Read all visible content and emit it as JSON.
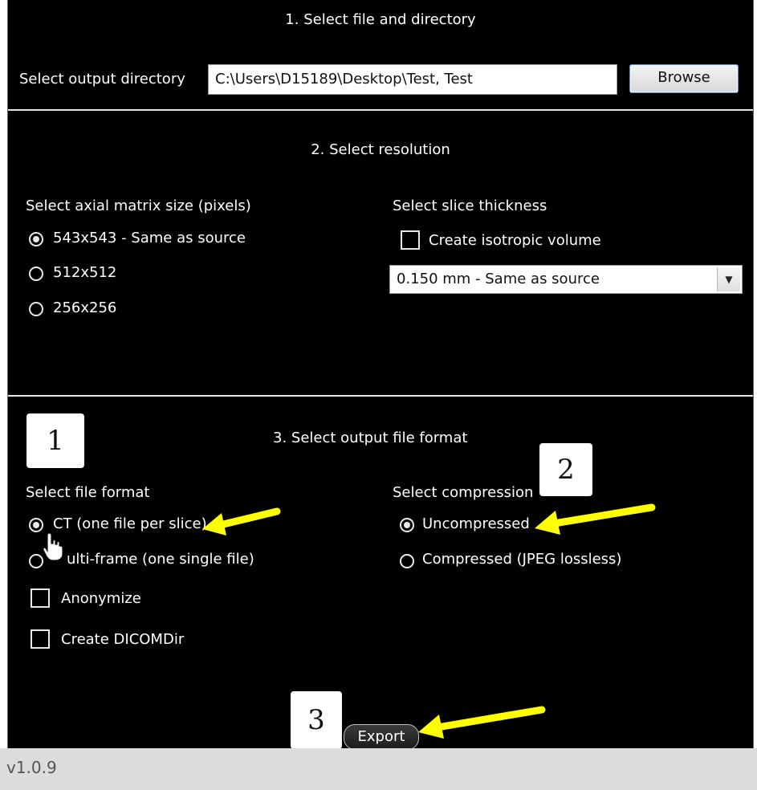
{
  "section1": {
    "title": "1. Select file and directory",
    "output_dir_label": "Select output directory",
    "output_dir_value": "C:\\Users\\D15189\\Desktop\\Test, Test",
    "browse_label": "Browse"
  },
  "section2": {
    "title": "2. Select resolution",
    "matrix_label": "Select axial matrix size (pixels)",
    "matrix_options": [
      {
        "label": "543x543 - Same as source",
        "selected": true
      },
      {
        "label": "512x512",
        "selected": false
      },
      {
        "label": "256x256",
        "selected": false
      }
    ],
    "slice_label": "Select slice thickness",
    "isotropic_label": "Create isotropic volume",
    "isotropic_checked": false,
    "slice_selected": "0.150 mm - Same as source"
  },
  "section3": {
    "title": "3. Select output file format",
    "format_label": "Select file format",
    "format_options": [
      {
        "label": "CT (one file per slice)",
        "selected": true
      },
      {
        "label": "ulti-frame (one single file)",
        "selected": false
      }
    ],
    "anonymize_label": "Anonymize",
    "dicomdir_label": "Create DICOMDir",
    "compression_label": "Select compression",
    "compression_options": [
      {
        "label": "Uncompressed",
        "selected": true
      },
      {
        "label": "Compressed (JPEG lossless)",
        "selected": false
      }
    ]
  },
  "callouts": [
    "1",
    "2",
    "3"
  ],
  "export_label": "Export",
  "version": "v1.0.9",
  "colors": {
    "panel_bg": "#000000",
    "arrow": "#ffff00",
    "text": "#ffffff"
  },
  "icons": [
    "hand-cursor-icon",
    "arrow-icon",
    "dropdown-arrow-icon"
  ]
}
